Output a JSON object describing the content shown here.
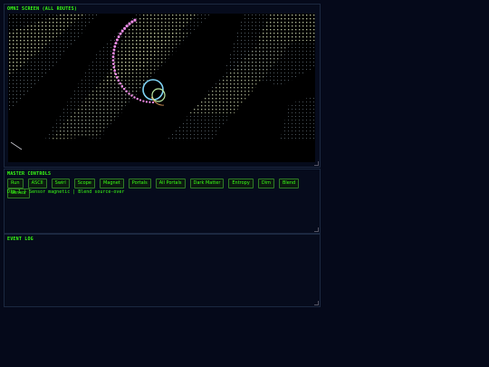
{
  "screen": {
    "title": "OMNI SCREEN (ALL ROUTES)"
  },
  "controls": {
    "title": "MASTER CONTROLS",
    "buttons": [
      "Run",
      "ASCII",
      "Swirl",
      "Scope",
      "Magnet",
      "Portals",
      "All Portals",
      "Dark Matter",
      "Entropy",
      "Dim",
      "Blend",
      "Sensor"
    ],
    "status": "Dim 1 | Sensor magnetic | Blend source-over"
  },
  "log": {
    "title": "EVENT LOG"
  },
  "colors": {
    "accent": "#39ff14",
    "trail": "#f08ce8",
    "ring1": "#7fd3f5",
    "ring2": "#b8e6a0"
  }
}
